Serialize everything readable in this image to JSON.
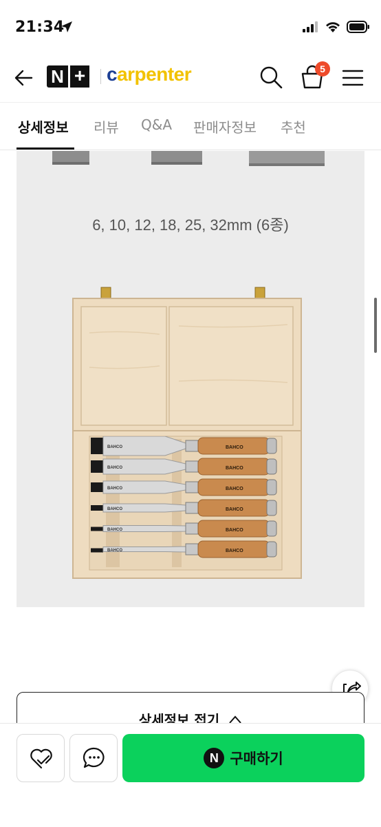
{
  "status_bar": {
    "time": "21:34",
    "icons": [
      "location-arrow-icon",
      "signal-icon",
      "wifi-icon",
      "battery-icon"
    ]
  },
  "header": {
    "brand_badge": "N+",
    "brand_name": "carpenter",
    "cart_count": "5",
    "icons": [
      "back-arrow-icon",
      "search-icon",
      "cart-icon",
      "menu-icon"
    ]
  },
  "tabs": [
    {
      "label": "상세정보",
      "active": true
    },
    {
      "label": "리뷰",
      "active": false
    },
    {
      "label": "Q&A",
      "active": false
    },
    {
      "label": "판매자정보",
      "active": false
    },
    {
      "label": "추천",
      "active": false
    }
  ],
  "content": {
    "sizes_caption": "6, 10, 12, 18, 25, 32mm (6종)",
    "chisel_brand": "BAHCO"
  },
  "collapse_button": {
    "label": "상세정보 접기"
  },
  "bottom_bar": {
    "buy_label": "구매하기",
    "npay_badge": "N"
  },
  "colors": {
    "buy_button": "#0bd15c",
    "cart_badge": "#ee4b2b",
    "brand_yellow": "#f2c200",
    "brand_blue": "#1c3f94"
  }
}
